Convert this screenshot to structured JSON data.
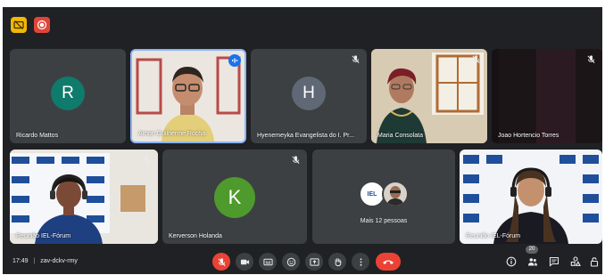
{
  "top_indicators": {
    "captions_icon": "captions-off-icon",
    "recording_icon": "recording-icon",
    "captions_color": "#f2b705",
    "recording_color": "#e0453a"
  },
  "participants": [
    {
      "name": "Ricardo Mattos",
      "initial": "R",
      "avatar_color": "#0f7b6c",
      "mic_muted": false
    },
    {
      "name": "Arnon Guilherme Rocha",
      "initial": "",
      "mic_muted": false,
      "speaking": true
    },
    {
      "name": "Hyenemeyka Evangelista do I. Pr...",
      "initial": "H",
      "avatar_color": "#606875",
      "mic_muted": true
    },
    {
      "name": "Maria Consolata",
      "initial": "",
      "mic_muted": true
    },
    {
      "name": "Joao Hortencio Torres",
      "initial": "",
      "mic_muted": true
    },
    {
      "name": "Reunião IEL-Fórum",
      "initial": "",
      "mic_muted": true
    },
    {
      "name": "Kerverson Holanda",
      "initial": "K",
      "avatar_color": "#4f9a2c",
      "mic_muted": true
    },
    {
      "name": "Mais 12 pessoas",
      "initial": "",
      "mic_muted": false
    },
    {
      "name": "Reunião IEL-Fórum",
      "initial": "",
      "mic_muted": false
    }
  ],
  "more_tile": {
    "badge_text": "IEL"
  },
  "bottom_bar": {
    "time": "17:49",
    "separator": "|",
    "meeting_code": "zav-dckv-rmy",
    "controls": [
      {
        "name": "mic-off-icon",
        "active": false
      },
      {
        "name": "video-camera-icon",
        "active": true
      },
      {
        "name": "captions-icon",
        "active": true
      },
      {
        "name": "emoji-icon",
        "active": true
      },
      {
        "name": "present-screen-icon",
        "active": true
      },
      {
        "name": "raise-hand-icon",
        "active": true
      },
      {
        "name": "more-options-icon",
        "active": true
      },
      {
        "name": "end-call-icon",
        "active": true
      }
    ],
    "right_icons": [
      "info-icon",
      "people-icon",
      "chat-icon",
      "activities-icon",
      "host-controls-icon"
    ],
    "people_count": "20"
  }
}
